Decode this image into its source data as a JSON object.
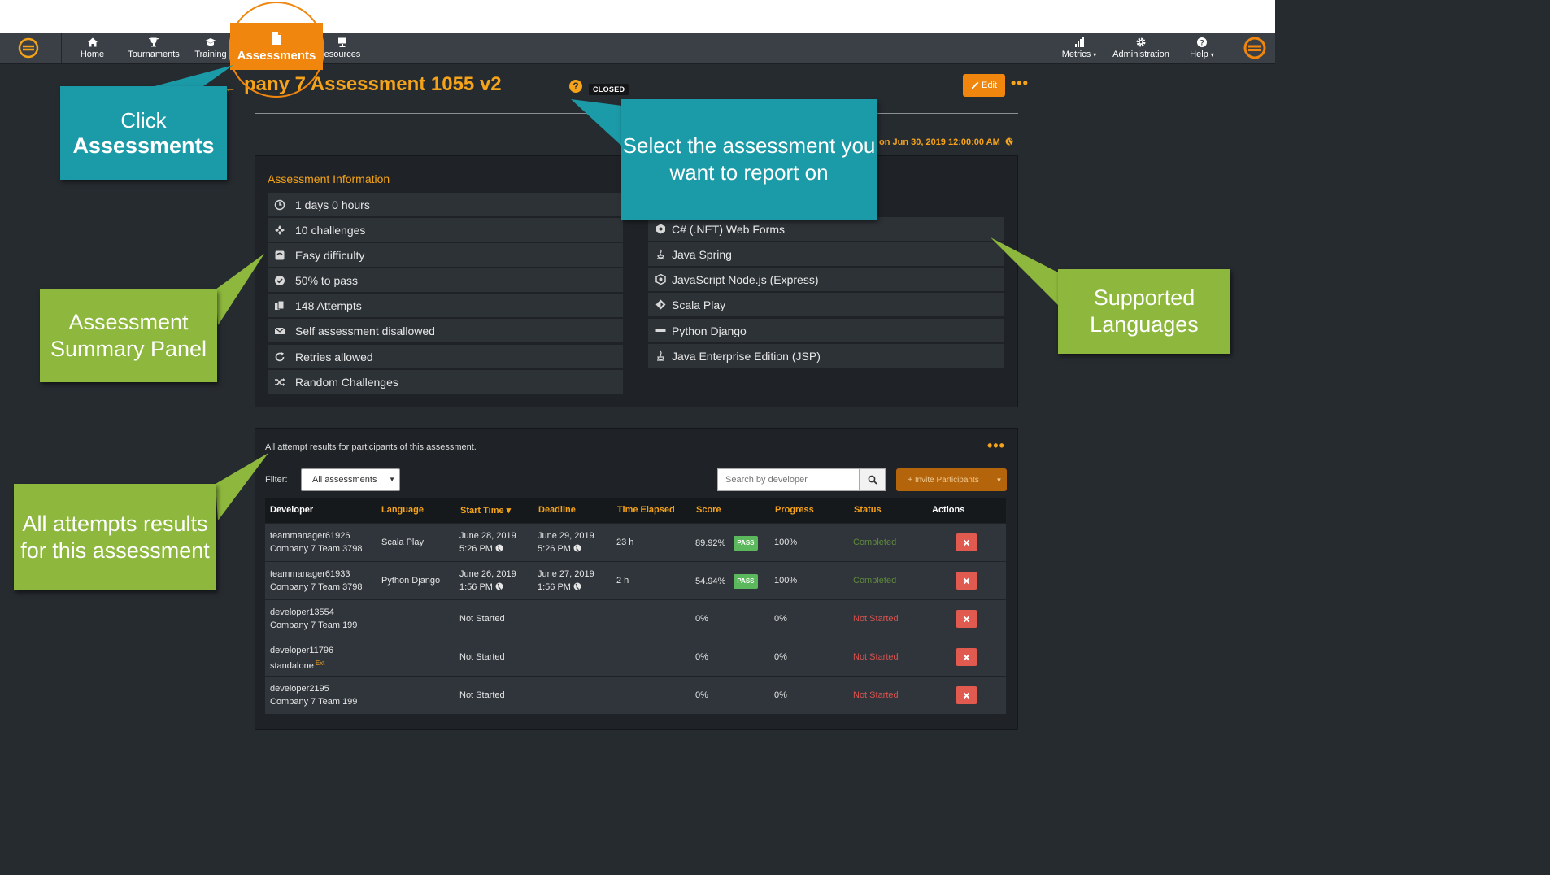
{
  "nav": {
    "items": [
      {
        "label": "Home",
        "icon": "home-icon"
      },
      {
        "label": "Tournaments",
        "icon": "trophy-icon"
      },
      {
        "label": "Training",
        "icon": "graduation-cap-icon"
      },
      {
        "label": "Assessments",
        "icon": "document-icon"
      },
      {
        "label": "esources",
        "icon": "presentation-icon"
      }
    ],
    "right": [
      {
        "label": "Metrics",
        "icon": "bar-chart-icon",
        "caret": "▾"
      },
      {
        "label": "Administration",
        "icon": "gear-icon"
      },
      {
        "label": "Help",
        "icon": "question-icon",
        "caret": "▾"
      }
    ],
    "brand_color": "#f5a31a"
  },
  "header": {
    "title": "pany 7 Assessment 1055 v2",
    "status": "CLOSED",
    "edit_label": "Edit",
    "more": "•••",
    "deadline_text": "on Jun 30, 2019 12:00:00 AM"
  },
  "info": {
    "title": "Assessment Information",
    "items": [
      {
        "text": "1 days 0 hours",
        "icon": "clock-icon"
      },
      {
        "text": "10 challenges",
        "icon": "puzzle-icon"
      },
      {
        "text": "Easy difficulty",
        "icon": "gauge-icon"
      },
      {
        "text": "50% to pass",
        "icon": "check-circle-icon"
      },
      {
        "text": "148 Attempts",
        "icon": "copies-icon"
      },
      {
        "text": "Self assessment disallowed",
        "icon": "envelope-icon"
      },
      {
        "text": "Retries allowed",
        "icon": "refresh-icon"
      },
      {
        "text": "Random Challenges",
        "icon": "shuffle-icon"
      }
    ]
  },
  "languages": {
    "items": [
      {
        "text": "C# (.NET) Web Forms",
        "icon": "hexagon-icon"
      },
      {
        "text": "Java Spring",
        "icon": "java-icon"
      },
      {
        "text": "JavaScript Node.js (Express)",
        "icon": "hexagon-icon"
      },
      {
        "text": "Scala Play",
        "icon": "diamond-icon"
      },
      {
        "text": "Python Django",
        "icon": "bar-icon"
      },
      {
        "text": "Java Enterprise Edition (JSP)",
        "icon": "java-icon"
      }
    ]
  },
  "results": {
    "description": "All attempt results for participants of this assessment.",
    "more": "•••",
    "filter_label": "Filter:",
    "filter_value": "All assessments",
    "search_placeholder": "Search by developer",
    "invite_label": "+ Invite Participants",
    "columns": [
      "Developer",
      "Language",
      "Start Time",
      "Deadline",
      "Time Elapsed",
      "Score",
      "Progress",
      "Status",
      "Actions"
    ],
    "sort_indicator": "▾",
    "pass_label": "PASS",
    "rows": [
      {
        "dev": "teammanager61926",
        "team": "Company 7 Team 3798",
        "ext": "",
        "lang": "Scala Play",
        "start1": "June 28, 2019",
        "start2": "5:26 PM",
        "dead1": "June 29, 2019",
        "dead2": "5:26 PM",
        "elapsed": "23 h",
        "score": "89.92%",
        "pass": true,
        "progress": "100%",
        "status": "Completed",
        "status_type": "completed"
      },
      {
        "dev": "teammanager61933",
        "team": "Company 7 Team 3798",
        "ext": "",
        "lang": "Python Django",
        "start1": "June 26, 2019",
        "start2": "1:56 PM",
        "dead1": "June 27, 2019",
        "dead2": "1:56 PM",
        "elapsed": "2 h",
        "score": "54.94%",
        "pass": true,
        "progress": "100%",
        "status": "Completed",
        "status_type": "completed"
      },
      {
        "dev": "developer13554",
        "team": "Company 7 Team 199",
        "ext": "",
        "lang": "",
        "start1": "Not Started",
        "start2": "",
        "dead1": "",
        "dead2": "",
        "elapsed": "",
        "score": "0%",
        "pass": false,
        "progress": "0%",
        "status": "Not Started",
        "status_type": "notstarted"
      },
      {
        "dev": "developer11796",
        "team": "standalone",
        "ext": "Ext",
        "lang": "",
        "start1": "Not Started",
        "start2": "",
        "dead1": "",
        "dead2": "",
        "elapsed": "",
        "score": "0%",
        "pass": false,
        "progress": "0%",
        "status": "Not Started",
        "status_type": "notstarted"
      },
      {
        "dev": "developer2195",
        "team": "Company 7 Team 199",
        "ext": "",
        "lang": "",
        "start1": "Not Started",
        "start2": "",
        "dead1": "",
        "dead2": "",
        "elapsed": "",
        "score": "0%",
        "pass": false,
        "progress": "0%",
        "status": "Not Started",
        "status_type": "notstarted"
      }
    ]
  },
  "callouts": {
    "click_line1": "Click",
    "click_line2": "Assessments",
    "select": "Select the assessment you want to report on",
    "summary": "Assessment Summary Panel",
    "languages": "Supported Languages",
    "attempts": "All attempts results for this assessment"
  },
  "colors": {
    "accent": "#f5a31a",
    "callout_teal": "#1b9aa7",
    "callout_green": "#8db83d",
    "pass": "#5cb85c",
    "danger": "#e05a4f"
  }
}
